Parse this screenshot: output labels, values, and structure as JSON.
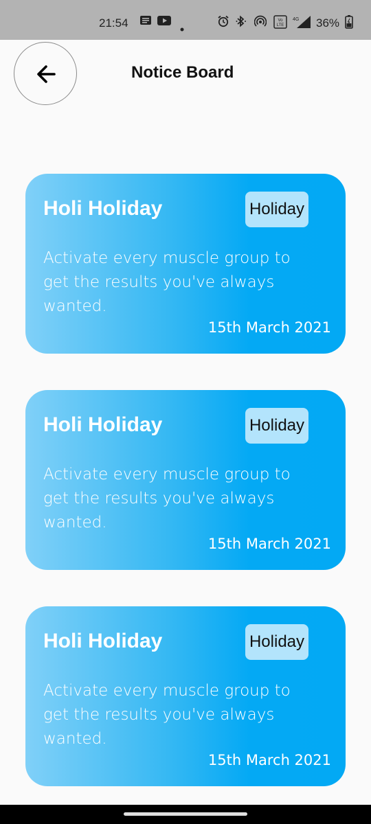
{
  "status_bar": {
    "time": "21:54",
    "battery": "36%",
    "network": "4G",
    "icons": [
      "message-icon",
      "youtube-icon",
      "dot-icon",
      "alarm-icon",
      "bluetooth-icon",
      "hotspot-icon",
      "volte-icon",
      "signal-icon",
      "battery-icon"
    ]
  },
  "header": {
    "back_icon": "arrow-left-icon",
    "title": "Notice Board"
  },
  "notices": [
    {
      "title": "Holi Holiday",
      "category": "Holiday",
      "description": "Activate every muscle group to get the results you've always wanted.",
      "date": "15th March 2021"
    },
    {
      "title": "Holi Holiday",
      "category": "Holiday",
      "description": "Activate every muscle group to get the results you've always wanted.",
      "date": "15th March 2021"
    },
    {
      "title": "Holi Holiday",
      "category": "Holiday",
      "description": "Activate every muscle group to get the results you've always wanted.",
      "date": "15th March 2021"
    }
  ],
  "colors": {
    "card_gradient_start": "#80d0f8",
    "card_gradient_end": "#03a9f4",
    "badge_bg": "#b3e4fc",
    "page_bg": "#fafafa"
  }
}
